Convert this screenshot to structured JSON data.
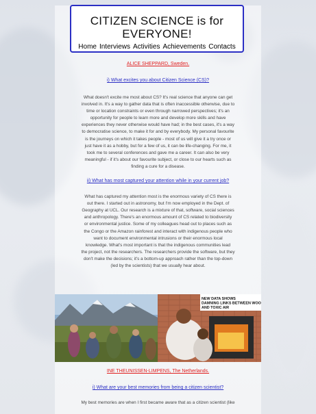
{
  "header": {
    "title_line1": "CITIZEN SCIENCE is for",
    "title_line2": "EVERYONE!",
    "nav": [
      "Home",
      "Interviews",
      "Activities",
      "Achievements",
      "Contacts"
    ]
  },
  "interview1": {
    "name": "ALICE SHEPPARD, Sweden.",
    "q1": "i) What excites you about Citizen Science (CS)?",
    "a1_lines": [
      "What doesn't excite me most about CS? It's real science that anyone can get",
      "involved in. It's a way to gather data that is often inaccessible otherwise, due to",
      "time or location constraints or even through narrowed perspectives; it's an",
      "opportunity for people to learn more and develop more skills and have",
      "experiences they never otherwise would have had; in the best cases, it's a way",
      "to democratise science, to make it for and by everybody. My personal favourite",
      "is the journeys on which it takes people - most of us will give it a try once or",
      "just have it as a hobby, but for a few of us, it can be life-changing. For me, it",
      "took me to several conferences and gave me a career. It can also be very",
      "meaningful - if it's about our favourite subject, or close to our hearts such as",
      "finding a cure for a disease."
    ],
    "q2": "ii) What has most captured your attention while in your current job?",
    "a2_lines": [
      "What has captured my attention most is the enormous variety of CS there is",
      "out there. I started out in astronomy, but I'm now employed in the Dept. of",
      "Geography at UCL. Our research is a mixture of that, software, social sciences",
      "and anthropology. There's an enormous amount of CS related to biodiversity",
      "or environmental justice. Some of my colleagues head out to places such as",
      "the Congo or the Amazon rainforest and interact with indigenous people who",
      "want to document environmental intrusions or their enormous local",
      "knowledge. What's most important is that the indigenous communities lead",
      "the project, not the researchers. The researchers provide the software, but they",
      "don't make the decisions; it's a bottom-up approach rather than the top-down",
      "(led by the scientists) that we usually hear about."
    ]
  },
  "photo_caption": "NEW DATA SHOWS DAMNING LINKS BETWEEN WOOD BURNERS AND TOXIC AIR",
  "interview2": {
    "name": "INE THEUNISSEN-LIMPENS, The Netherlands.",
    "q1": "i) What are your best memories from being a citizen scientist?",
    "a1_line": "My best memories are when I first became aware that as a citizen scientist (like"
  }
}
